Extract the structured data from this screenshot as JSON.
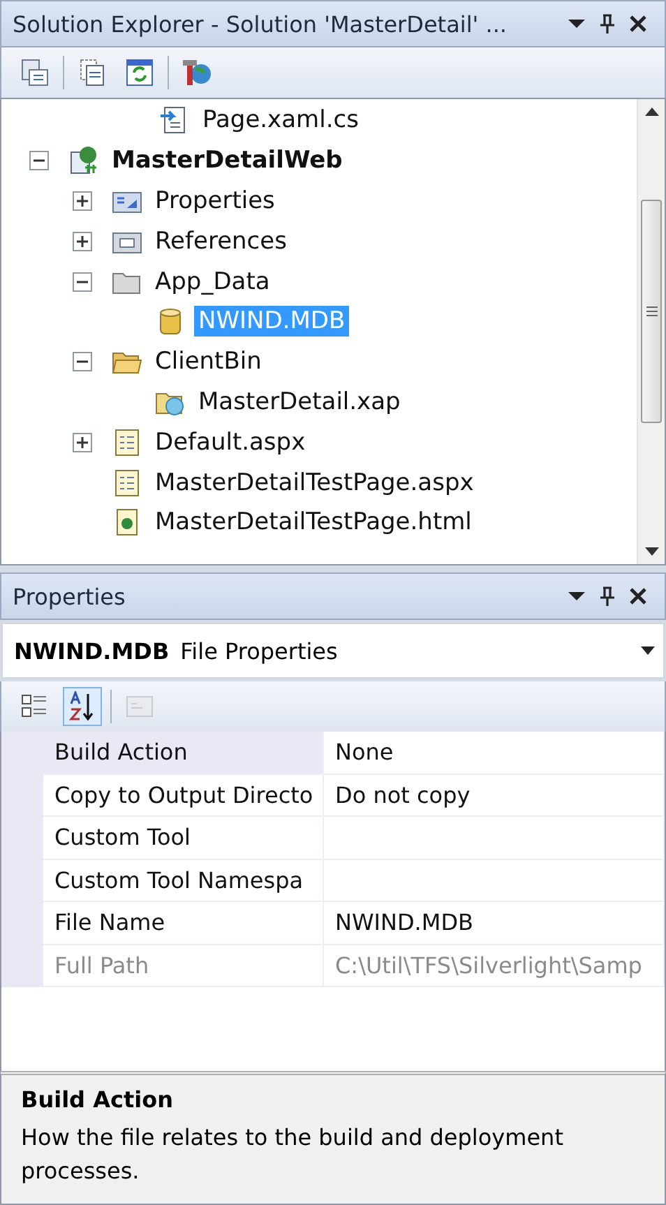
{
  "solution_explorer": {
    "title": "Solution Explorer - Solution 'MasterDetail' ...",
    "partial_item": {
      "label": "Page.xaml.cs",
      "kind": "code",
      "selected": false
    },
    "tree": [
      {
        "label": "MasterDetailWeb",
        "kind": "project",
        "expanded": true,
        "selected": false,
        "children": [
          {
            "label": "Properties",
            "kind": "properties",
            "expanded": false,
            "selected": false
          },
          {
            "label": "References",
            "kind": "references",
            "expanded": false,
            "selected": false
          },
          {
            "label": "App_Data",
            "kind": "folder",
            "expanded": true,
            "selected": false,
            "children": [
              {
                "label": "NWIND.MDB",
                "kind": "database",
                "selected": true
              }
            ]
          },
          {
            "label": "ClientBin",
            "kind": "openfolder",
            "expanded": true,
            "selected": false,
            "children": [
              {
                "label": "MasterDetail.xap",
                "kind": "package",
                "selected": false
              }
            ]
          },
          {
            "label": "Default.aspx",
            "kind": "page",
            "expanded": false,
            "selected": false
          },
          {
            "label": "MasterDetailTestPage.aspx",
            "kind": "page",
            "selected": false
          },
          {
            "label": "MasterDetailTestPage.html",
            "kind": "webpage",
            "selected": false
          }
        ]
      }
    ]
  },
  "properties": {
    "title": "Properties",
    "object_name": "NWIND.MDB",
    "object_type": "File Properties",
    "toolbar": [
      {
        "kind": "categorized",
        "selected": false
      },
      {
        "kind": "alphabetical",
        "selected": true
      },
      {
        "kind": "pages",
        "selected": false,
        "disabled": true
      }
    ],
    "rows": [
      {
        "name": "Build Action",
        "value": "None",
        "selected": true,
        "disabled": false
      },
      {
        "name": "Copy to Output Directo",
        "value": "Do not copy",
        "selected": false,
        "disabled": false
      },
      {
        "name": "Custom Tool",
        "selected": false,
        "disabled": false
      },
      {
        "name": "Custom Tool Namespa",
        "selected": false,
        "disabled": false
      },
      {
        "name": "File Name",
        "value": "NWIND.MDB",
        "selected": false,
        "disabled": false
      },
      {
        "name": "Full Path",
        "value": "C:\\Util\\TFS\\Silverlight\\Samp",
        "selected": false,
        "disabled": true
      }
    ],
    "description": {
      "title": "Build Action",
      "text": "How the file relates to the build and deployment processes."
    }
  }
}
